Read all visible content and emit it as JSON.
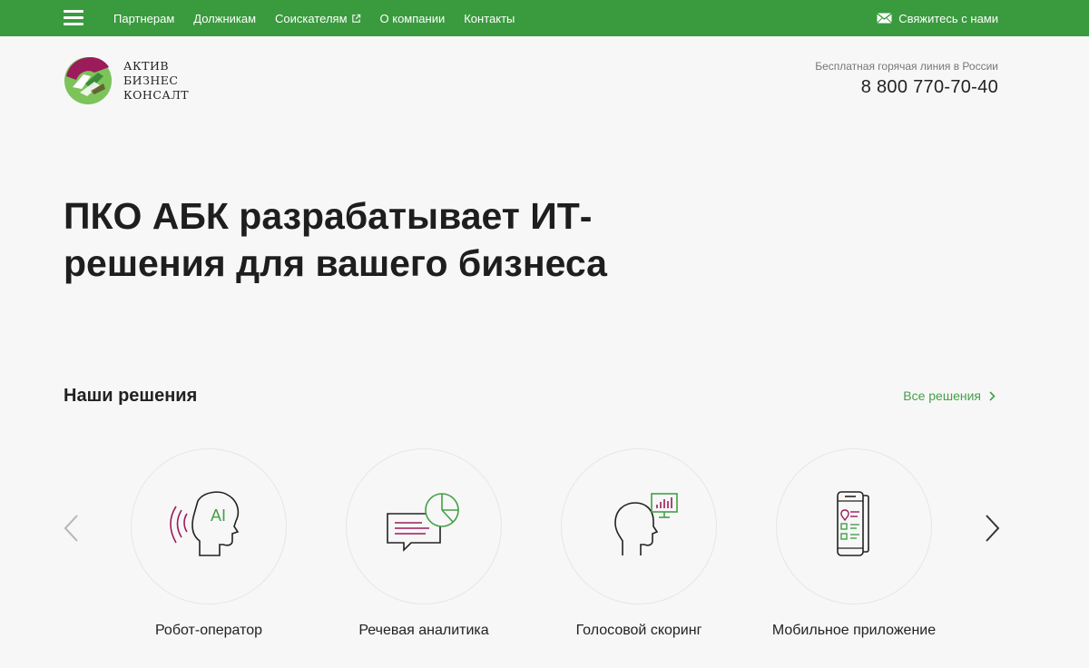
{
  "topbar": {
    "nav": [
      {
        "label": "Партнерам"
      },
      {
        "label": "Должникам"
      },
      {
        "label": "Соискателям"
      },
      {
        "label": "О компании"
      },
      {
        "label": "Контакты"
      }
    ],
    "contact_label": "Свяжитесь с нами"
  },
  "logo": {
    "line1": "АКТИВ",
    "line2": "БИЗНЕС",
    "line3": "КОНСАЛТ"
  },
  "hotline": {
    "label": "Бесплатная горячая линия в России",
    "phone": "8 800 770-70-40"
  },
  "hero": {
    "title": "ПКО АБК разрабатывает ИТ-решения для вашего бизнеса"
  },
  "solutions": {
    "title": "Наши решения",
    "all_link": "Все решения",
    "items": [
      {
        "label": "Робот-оператор",
        "icon": "robot-operator-icon"
      },
      {
        "label": "Речевая аналитика",
        "icon": "speech-analytics-icon"
      },
      {
        "label": "Голосовой скоринг",
        "icon": "voice-scoring-icon"
      },
      {
        "label": "Мобильное приложение",
        "icon": "mobile-app-icon"
      }
    ]
  },
  "colors": {
    "brand_green": "#3a9a3e",
    "accent_purple": "#9c1b5a",
    "link_green": "#43a047"
  }
}
